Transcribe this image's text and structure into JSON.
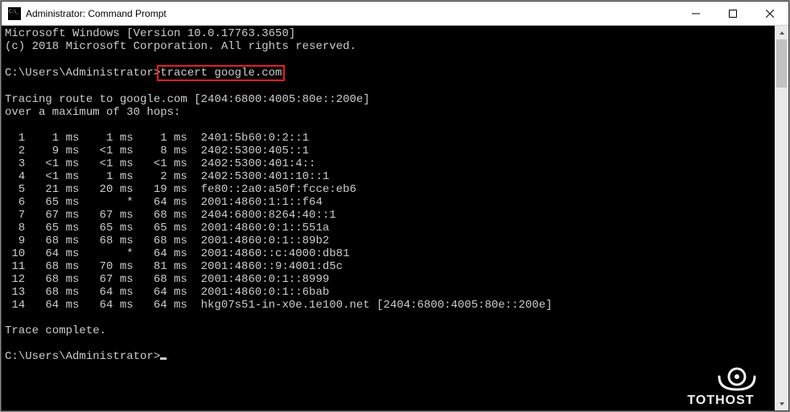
{
  "titlebar": {
    "icon_name": "cmd-icon",
    "title": "Administrator: Command Prompt",
    "minimize": "minimize-button",
    "maximize": "maximize-button",
    "close": "close-button"
  },
  "header": {
    "line1": "Microsoft Windows [Version 10.0.17763.3650]",
    "line2": "(c) 2018 Microsoft Corporation. All rights reserved."
  },
  "prompt1": {
    "prefix": "C:\\Users\\Administrator>",
    "command": "tracert google.com"
  },
  "trace_header": {
    "line1": "Tracing route to google.com [2404:6800:4005:80e::200e]",
    "line2": "over a maximum of 30 hops:"
  },
  "hops": [
    {
      "n": "1",
      "t1": "1 ms",
      "t2": "1 ms",
      "t3": "1 ms",
      "host": "2401:5b60:0:2::1"
    },
    {
      "n": "2",
      "t1": "9 ms",
      "t2": "<1 ms",
      "t3": "8 ms",
      "host": "2402:5300:405::1"
    },
    {
      "n": "3",
      "t1": "<1 ms",
      "t2": "<1 ms",
      "t3": "<1 ms",
      "host": "2402:5300:401:4::"
    },
    {
      "n": "4",
      "t1": "<1 ms",
      "t2": "1 ms",
      "t3": "2 ms",
      "host": "2402:5300:401:10::1"
    },
    {
      "n": "5",
      "t1": "21 ms",
      "t2": "20 ms",
      "t3": "19 ms",
      "host": "fe80::2a0:a50f:fcce:eb6"
    },
    {
      "n": "6",
      "t1": "65 ms",
      "t2": "*",
      "t3": "64 ms",
      "host": "2001:4860:1:1::f64"
    },
    {
      "n": "7",
      "t1": "67 ms",
      "t2": "67 ms",
      "t3": "68 ms",
      "host": "2404:6800:8264:40::1"
    },
    {
      "n": "8",
      "t1": "65 ms",
      "t2": "65 ms",
      "t3": "65 ms",
      "host": "2001:4860:0:1::551a"
    },
    {
      "n": "9",
      "t1": "68 ms",
      "t2": "68 ms",
      "t3": "68 ms",
      "host": "2001:4860:0:1::89b2"
    },
    {
      "n": "10",
      "t1": "64 ms",
      "t2": "*",
      "t3": "64 ms",
      "host": "2001:4860::c:4000:db81"
    },
    {
      "n": "11",
      "t1": "68 ms",
      "t2": "70 ms",
      "t3": "81 ms",
      "host": "2001:4860::9:4001:d5c"
    },
    {
      "n": "12",
      "t1": "68 ms",
      "t2": "67 ms",
      "t3": "68 ms",
      "host": "2001:4860:0:1::8999"
    },
    {
      "n": "13",
      "t1": "68 ms",
      "t2": "64 ms",
      "t3": "64 ms",
      "host": "2001:4860:0:1::6bab"
    },
    {
      "n": "14",
      "t1": "64 ms",
      "t2": "64 ms",
      "t3": "64 ms",
      "host": "hkg07s51-in-x0e.1e100.net [2404:6800:4005:80e::200e]"
    }
  ],
  "trace_footer": "Trace complete.",
  "prompt2": {
    "prefix": "C:\\Users\\Administrator>"
  },
  "branding": "TOTHOST"
}
